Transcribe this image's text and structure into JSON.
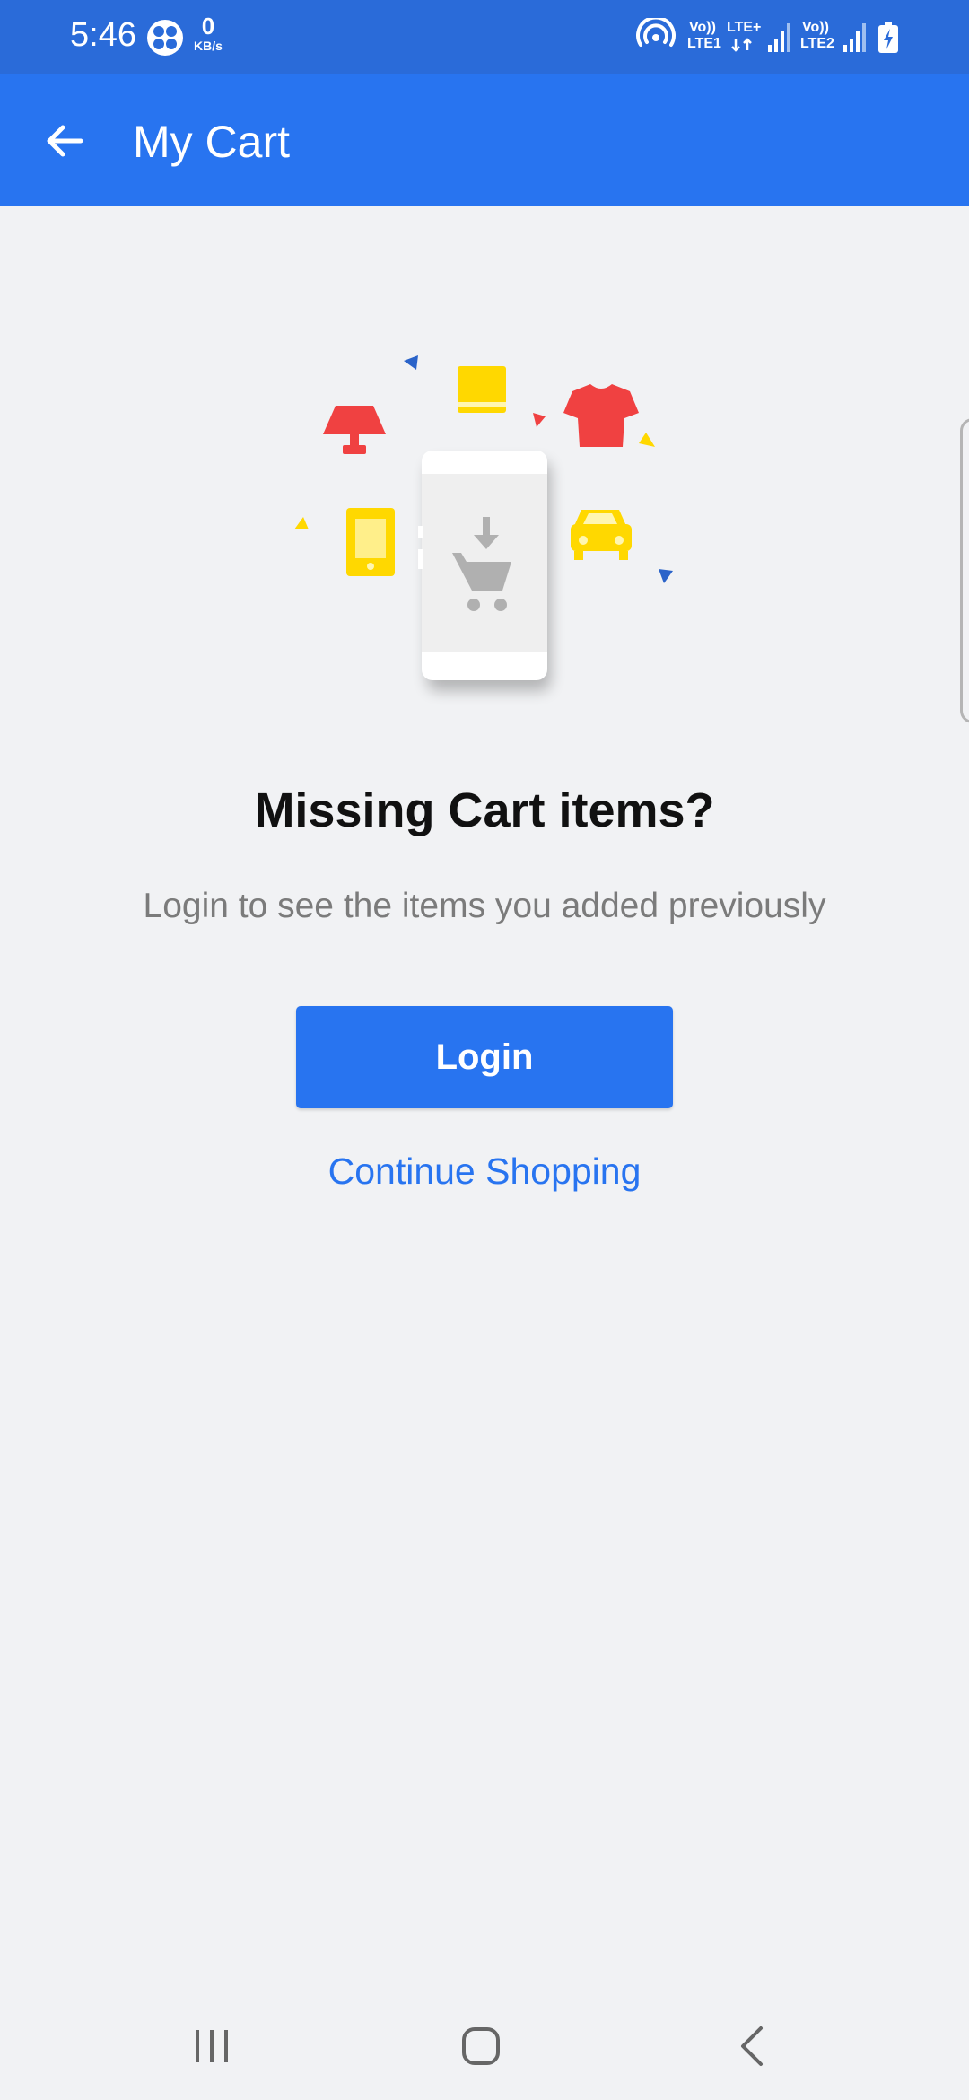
{
  "status_bar": {
    "time": "5:46",
    "net_speed_value": "0",
    "net_speed_unit": "KB/s",
    "sim1_top": "Vo))",
    "sim1_mid": "LTE+",
    "sim1_bottom": "LTE1",
    "sim2_top": "Vo))",
    "sim2_bottom": "LTE2",
    "icons": [
      "fan-icon",
      "hotspot-icon",
      "signal-icon",
      "signal-icon",
      "battery-charging-icon"
    ]
  },
  "app_bar": {
    "title": "My Cart",
    "back_icon": "arrow-left-icon"
  },
  "empty_state": {
    "illustration": "cart-phone-illustration",
    "title": "Missing Cart items?",
    "subtitle": "Login to see the items you added previously",
    "login_label": "Login",
    "continue_label": "Continue Shopping"
  },
  "nav_bar": {
    "icons": [
      "recents-icon",
      "home-icon",
      "back-icon"
    ]
  },
  "colors": {
    "status_bar": "#2a6bd9",
    "app_bar": "#2874f0",
    "background": "#f1f2f4",
    "accent_red": "#f04141",
    "accent_yellow": "#ffd800",
    "accent_blue": "#2a63c9"
  }
}
